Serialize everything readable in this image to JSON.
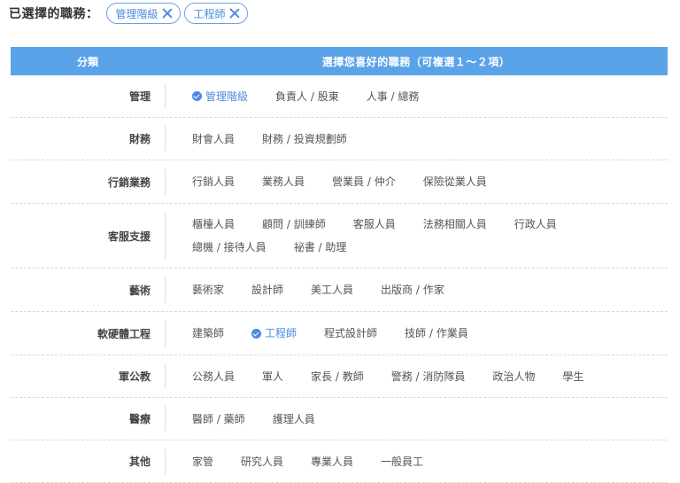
{
  "selected": {
    "title": "已選擇的職務：",
    "chips": [
      "管理階級",
      "工程師"
    ]
  },
  "table": {
    "header_category": "分類",
    "header_options": "選擇您喜好的職務（可複選１～２項）",
    "rows": [
      {
        "category": "管理",
        "options": [
          {
            "label": "管理階級",
            "selected": true
          },
          {
            "label": "負責人 / 股東",
            "selected": false
          },
          {
            "label": "人事 / 總務",
            "selected": false
          }
        ]
      },
      {
        "category": "財務",
        "options": [
          {
            "label": "財會人員",
            "selected": false
          },
          {
            "label": "財務 / 投資規劃師",
            "selected": false
          }
        ]
      },
      {
        "category": "行銷業務",
        "options": [
          {
            "label": "行銷人員",
            "selected": false
          },
          {
            "label": "業務人員",
            "selected": false
          },
          {
            "label": "營業員 / 仲介",
            "selected": false
          },
          {
            "label": "保險從業人員",
            "selected": false
          }
        ]
      },
      {
        "category": "客服支援",
        "options": [
          {
            "label": "櫃檯人員",
            "selected": false
          },
          {
            "label": "顧問 / 訓練師",
            "selected": false
          },
          {
            "label": "客服人員",
            "selected": false
          },
          {
            "label": "法務相關人員",
            "selected": false
          },
          {
            "label": "行政人員",
            "selected": false
          },
          {
            "label": "總機 / 接待人員",
            "selected": false
          },
          {
            "label": "祕書 / 助理",
            "selected": false
          }
        ]
      },
      {
        "category": "藝術",
        "options": [
          {
            "label": "藝術家",
            "selected": false
          },
          {
            "label": "設計師",
            "selected": false
          },
          {
            "label": "美工人員",
            "selected": false
          },
          {
            "label": "出版商 / 作家",
            "selected": false
          }
        ]
      },
      {
        "category": "軟硬體工程",
        "options": [
          {
            "label": "建築師",
            "selected": false
          },
          {
            "label": "工程師",
            "selected": true
          },
          {
            "label": "程式設計師",
            "selected": false
          },
          {
            "label": "技師 / 作業員",
            "selected": false
          }
        ]
      },
      {
        "category": "軍公教",
        "options": [
          {
            "label": "公務人員",
            "selected": false
          },
          {
            "label": "軍人",
            "selected": false
          },
          {
            "label": "家長 / 教師",
            "selected": false
          },
          {
            "label": "警務 / 消防隊員",
            "selected": false
          },
          {
            "label": "政治人物",
            "selected": false
          },
          {
            "label": "學生",
            "selected": false
          }
        ]
      },
      {
        "category": "醫療",
        "options": [
          {
            "label": "醫師 / 藥師",
            "selected": false
          },
          {
            "label": "護理人員",
            "selected": false
          }
        ]
      },
      {
        "category": "其他",
        "options": [
          {
            "label": "家管",
            "selected": false
          },
          {
            "label": "研究人員",
            "selected": false
          },
          {
            "label": "專業人員",
            "selected": false
          },
          {
            "label": "一般員工",
            "selected": false
          }
        ]
      }
    ]
  }
}
